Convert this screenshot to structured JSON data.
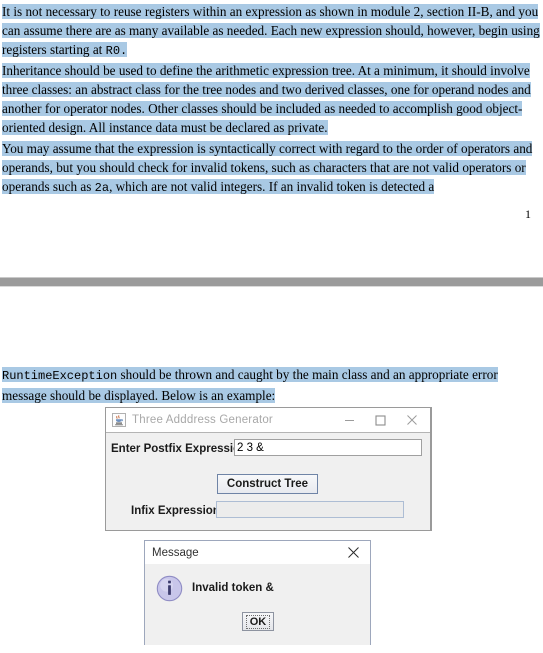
{
  "document": {
    "paragraphs": [
      {
        "id": "para1",
        "runs": [
          {
            "text": "It is not necessary to reuse registers within an expression as shown in module 2, section II-B, and you can assume there are as many available as needed. Each new expression should, however, begin using registers starting at ",
            "mono": false
          },
          {
            "text": "R0.",
            "mono": true
          }
        ]
      },
      {
        "id": "para2",
        "runs": [
          {
            "text": "Inheritance should be used to define the arithmetic expression tree. At a minimum, it should involve three classes: an abstract class for the tree nodes and two derived classes, one for operand nodes and another for operator nodes. Other classes should be included as needed to accomplish good object-oriented design. All instance data must be declared as private.",
            "mono": false
          }
        ]
      },
      {
        "id": "para3",
        "runs": [
          {
            "text": "You may assume that the expression is syntactically correct with regard to the order of operators and operands, but you should check for invalid tokens, such as characters that are not valid operators or operands such as ",
            "mono": false
          },
          {
            "text": "2a",
            "mono": true
          },
          {
            "text": ", which are not valid integers. If an invalid token is detected a",
            "mono": false
          }
        ]
      },
      {
        "id": "para4",
        "runs": [
          {
            "text": "RuntimeException",
            "mono": true
          },
          {
            "text": " should be thrown and caught by the main class and an appropriate error message should be displayed. Below is an example:",
            "mono": false
          }
        ]
      }
    ],
    "page_number": "1",
    "highlight_color": "#a9c9e4",
    "page_break_color": "#9b9b9b"
  },
  "java_window": {
    "title": "Three Adddress Generator",
    "icon": "java-coffee-cup-icon",
    "window_buttons": {
      "minimize": "minimize-icon",
      "maximize": "maximize-icon",
      "close": "close-icon"
    },
    "postfix": {
      "label": "Enter Postfix Expression",
      "value": "2 3 &",
      "placeholder": ""
    },
    "construct_button": "Construct Tree",
    "infix": {
      "label": "Infix Expression",
      "value": "",
      "placeholder": ""
    }
  },
  "message_dialog": {
    "title": "Message",
    "close_icon": "close-icon",
    "info_icon": "information-icon",
    "text": "Invalid token &",
    "ok_button": "OK",
    "info_icon_color": "#c6c4e8"
  }
}
